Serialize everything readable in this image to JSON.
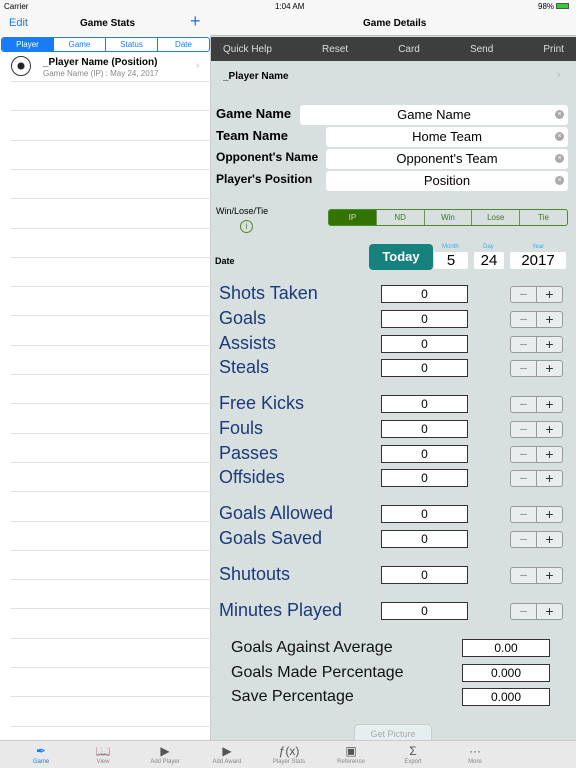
{
  "status": {
    "carrier": "Carrier",
    "time": "1:04 AM",
    "battery": "98%"
  },
  "left": {
    "edit": "Edit",
    "title": "Game Stats",
    "add": "+",
    "segments": [
      "Player",
      "Game",
      "Status",
      "Date"
    ],
    "selected_segment": "Player",
    "items": [
      {
        "title": "_Player Name (Position)",
        "subtitle": "Game Name (IP) : May 24, 2017"
      }
    ]
  },
  "right": {
    "title": "Game Details",
    "toolbar": [
      "Quick Help",
      "Reset",
      "Card",
      "Send",
      "Print"
    ],
    "player_name": "_Player Name",
    "fields": [
      {
        "label": "Game Name",
        "value": "Game Name"
      },
      {
        "label": "Team Name",
        "value": "Home Team"
      },
      {
        "label": "Opponent's Name",
        "value": "Opponent's Team"
      },
      {
        "label": "Player's Position",
        "value": "Position"
      }
    ],
    "wlt_label": "Win/Lose/Tie",
    "wlt_options": [
      "IP",
      "ND",
      "Win",
      "Lose",
      "Tie"
    ],
    "wlt_selected": "IP",
    "date_label": "Date",
    "today": "Today",
    "month_label": "Month",
    "day_label": "Day",
    "year_label": "Year",
    "month": "5",
    "day": "24",
    "year": "2017",
    "stats": [
      {
        "label": "Shots Taken",
        "value": "0"
      },
      {
        "label": "Goals",
        "value": "0"
      },
      {
        "label": "Assists",
        "value": "0"
      },
      {
        "label": "Steals",
        "value": "0"
      },
      {
        "label": "Free Kicks",
        "value": "0"
      },
      {
        "label": "Fouls",
        "value": "0"
      },
      {
        "label": "Passes",
        "value": "0"
      },
      {
        "label": "Offsides",
        "value": "0"
      },
      {
        "label": "Goals Allowed",
        "value": "0"
      },
      {
        "label": "Goals Saved",
        "value": "0"
      },
      {
        "label": "Shutouts",
        "value": "0"
      },
      {
        "label": "Minutes Played",
        "value": "0"
      }
    ],
    "calculated": [
      {
        "label": "Goals Against Average",
        "value": "0.00"
      },
      {
        "label": "Goals Made Percentage",
        "value": "0.000"
      },
      {
        "label": "Save Percentage",
        "value": "0.000"
      }
    ],
    "get_picture": "Get Picture"
  },
  "tabbar": [
    {
      "label": "Game",
      "icon": "quill-icon"
    },
    {
      "label": "View",
      "icon": "book-icon"
    },
    {
      "label": "Add Player",
      "icon": "document-add-icon"
    },
    {
      "label": "Add Award",
      "icon": "document-add-icon"
    },
    {
      "label": "Player Stats",
      "icon": "function-icon"
    },
    {
      "label": "Reference",
      "icon": "briefcase-icon"
    },
    {
      "label": "Export",
      "icon": "sigma-icon"
    },
    {
      "label": "More",
      "icon": "more-icon"
    }
  ],
  "colors": {
    "accent": "#1a7cf5",
    "today": "#17817d",
    "wlt_selected": "#337400",
    "stat_label": "#1c3a7a",
    "toolbar": "#3d3f3f"
  }
}
